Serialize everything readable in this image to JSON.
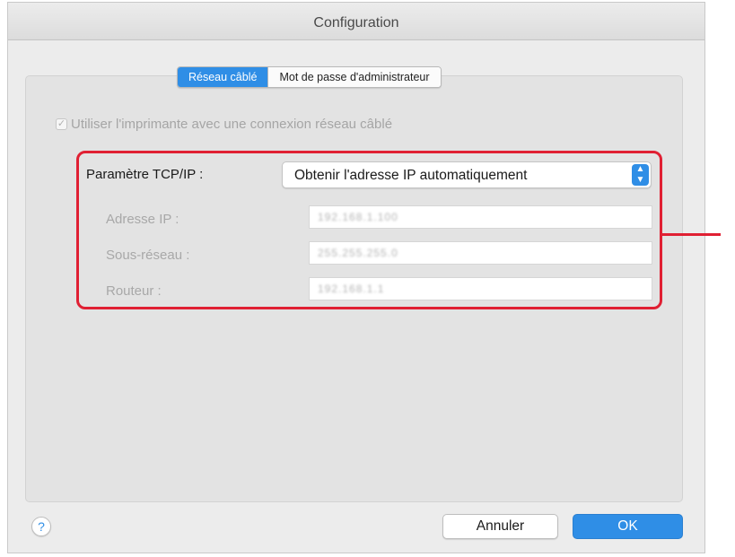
{
  "window": {
    "title": "Configuration"
  },
  "tabs": [
    {
      "label": "Réseau câblé",
      "active": true
    },
    {
      "label": "Mot de passe d'administrateur",
      "active": false
    }
  ],
  "checkbox": {
    "label": "Utiliser l'imprimante avec une connexion réseau câblé",
    "checked": true,
    "disabled": true
  },
  "tcp": {
    "label": "Paramètre TCP/IP :",
    "selected": "Obtenir l'adresse IP automatiquement"
  },
  "fields": [
    {
      "label": "Adresse IP :",
      "value": "192.168.1.100"
    },
    {
      "label": "Sous-réseau :",
      "value": "255.255.255.0"
    },
    {
      "label": "Routeur :",
      "value": "192.168.1.1"
    }
  ],
  "buttons": {
    "help": "?",
    "cancel": "Annuler",
    "ok": "OK"
  },
  "colors": {
    "accent": "#2f8ee6",
    "highlight": "#e02033"
  },
  "icons": {
    "checkbox": "checkmark-icon",
    "select": "up-down-chevron-icon"
  }
}
